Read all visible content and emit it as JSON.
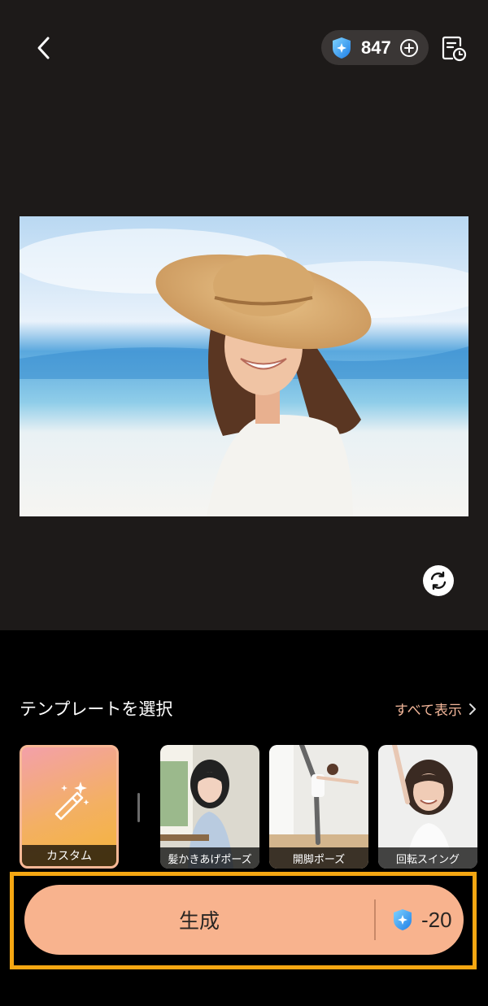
{
  "header": {
    "back_icon": "chevron-left-icon",
    "credits": "847",
    "credit_icon": "shield-sparkle-icon",
    "add_icon": "plus-circle-icon",
    "history_icon": "document-clock-icon"
  },
  "preview": {
    "refresh_icon": "refresh-icon"
  },
  "templates": {
    "section_title": "テンプレートを選択",
    "see_all": "すべて表示",
    "items": [
      {
        "label": "カスタム",
        "icon": "magic-wand-icon",
        "selected": true
      },
      {
        "label": "髪かきあげポーズ",
        "selected": false
      },
      {
        "label": "開脚ポーズ",
        "selected": false
      },
      {
        "label": "回転スイング",
        "selected": false
      }
    ]
  },
  "generate": {
    "label": "生成",
    "cost": "-20"
  },
  "colors": {
    "accent": "#f8b38e",
    "highlight": "#f5a712",
    "see_all": "#f4b79a"
  }
}
